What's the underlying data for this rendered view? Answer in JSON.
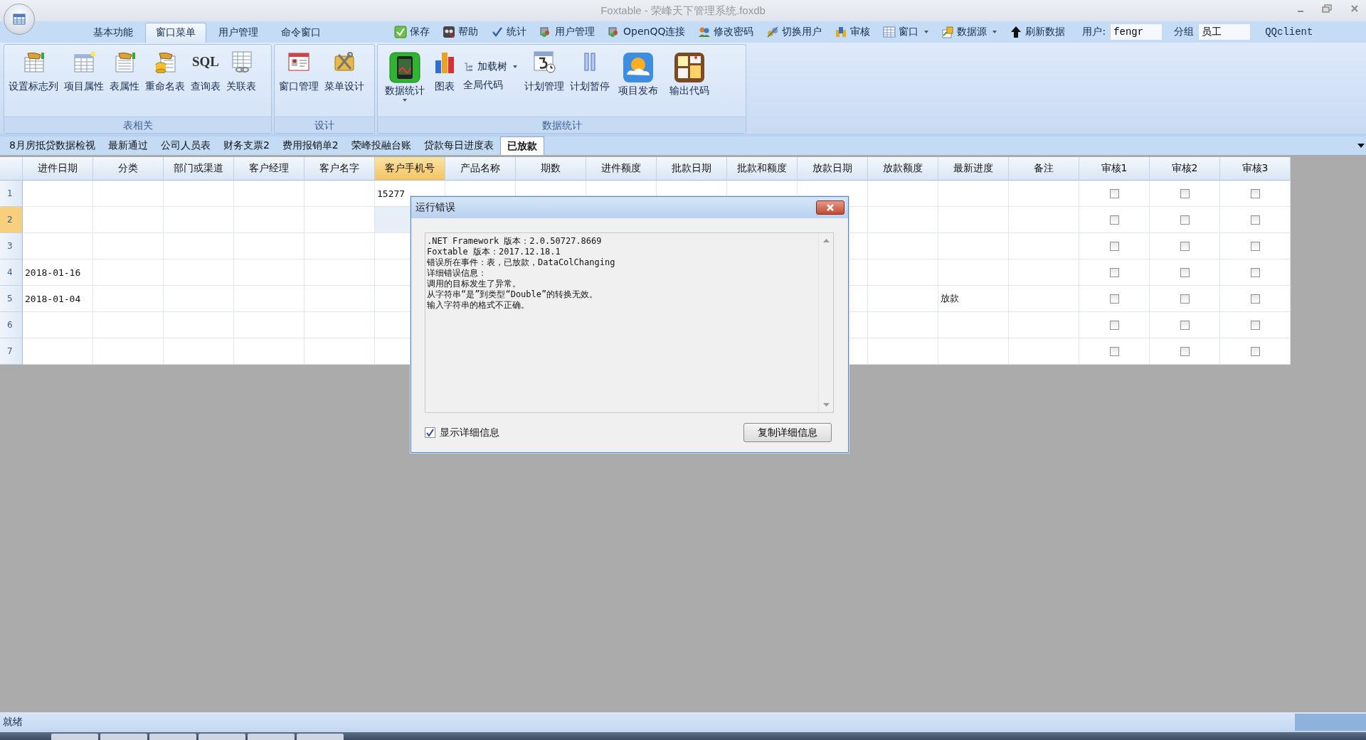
{
  "window": {
    "title": "Foxtable - 荣峰天下管理系统.foxdb"
  },
  "menu_tabs": [
    {
      "label": "基本功能",
      "selected": false
    },
    {
      "label": "窗口菜单",
      "selected": true
    },
    {
      "label": "用户管理",
      "selected": false
    },
    {
      "label": "命令窗口",
      "selected": false
    }
  ],
  "quick_tools": [
    {
      "label": "保存",
      "kind": "check",
      "dropdown": false
    },
    {
      "label": "帮助",
      "kind": "help",
      "dropdown": false
    },
    {
      "label": "统计",
      "kind": "tick",
      "dropdown": false
    },
    {
      "label": "用户管理",
      "kind": "users",
      "dropdown": false
    },
    {
      "label": "OpenQQ连接",
      "kind": "users",
      "dropdown": false
    },
    {
      "label": "修改密码",
      "kind": "people",
      "dropdown": false
    },
    {
      "label": "切换用户",
      "kind": "switch",
      "dropdown": false
    },
    {
      "label": "审核",
      "kind": "coins",
      "dropdown": false
    },
    {
      "label": "窗口",
      "kind": "grid",
      "dropdown": true
    },
    {
      "label": "数据源",
      "kind": "database",
      "dropdown": true
    },
    {
      "label": "刷新数据",
      "kind": "up",
      "dropdown": false
    }
  ],
  "user": {
    "label": "用户:",
    "value": "fengr"
  },
  "group": {
    "label": "分组",
    "value": "员工"
  },
  "qq_client": "QQclient",
  "ribbon_groups": [
    {
      "title": "表相关",
      "items": [
        {
          "label": "设置标志列",
          "kind": "large",
          "dropdown": false
        },
        {
          "label": "项目属性",
          "kind": "large",
          "dropdown": false
        },
        {
          "label": "表属性",
          "kind": "large",
          "dropdown": false
        },
        {
          "label": "重命名表",
          "kind": "large",
          "dropdown": false
        },
        {
          "label": "查询表",
          "kind": "large",
          "icon_text": "SQL",
          "dropdown": false
        },
        {
          "label": "关联表",
          "kind": "large",
          "dropdown": false
        }
      ]
    },
    {
      "title": "设计",
      "items": [
        {
          "label": "窗口管理",
          "kind": "large",
          "dropdown": false
        },
        {
          "label": "菜单设计",
          "kind": "large",
          "dropdown": false
        }
      ]
    },
    {
      "title": "数据统计",
      "items": [
        {
          "label": "数据统计",
          "kind": "big",
          "dropdown": true
        },
        {
          "label": "图表",
          "kind": "large",
          "dropdown": false
        },
        {
          "kind": "stack",
          "items": [
            {
              "label": "加载树",
              "dropdown": true
            },
            {
              "label": "全局代码",
              "dropdown": false
            }
          ]
        },
        {
          "label": "计划管理",
          "kind": "large",
          "dropdown": false
        },
        {
          "label": "计划暂停",
          "kind": "large",
          "dropdown": false
        },
        {
          "label": "项目发布",
          "kind": "big",
          "dropdown": false
        },
        {
          "label": "输出代码",
          "kind": "big",
          "dropdown": false
        }
      ]
    }
  ],
  "sheet_tabs": [
    {
      "label": "8月房抵贷数据检视",
      "selected": false
    },
    {
      "label": "最新通过",
      "selected": false
    },
    {
      "label": "公司人员表",
      "selected": false
    },
    {
      "label": "财务支票2",
      "selected": false
    },
    {
      "label": "费用报销单2",
      "selected": false
    },
    {
      "label": "荣峰投融台账",
      "selected": false
    },
    {
      "label": "贷款每日进度表",
      "selected": false
    },
    {
      "label": "已放款",
      "selected": true
    }
  ],
  "table": {
    "columns": [
      {
        "label": "进件日期",
        "current": false,
        "kind": "text"
      },
      {
        "label": "分类",
        "current": false,
        "kind": "text"
      },
      {
        "label": "部门或渠道",
        "current": false,
        "kind": "text"
      },
      {
        "label": "客户经理",
        "current": false,
        "kind": "text"
      },
      {
        "label": "客户名字",
        "current": false,
        "kind": "text"
      },
      {
        "label": "客户手机号",
        "current": true,
        "kind": "text"
      },
      {
        "label": "产品名称",
        "current": false,
        "kind": "text"
      },
      {
        "label": "期数",
        "current": false,
        "kind": "text"
      },
      {
        "label": "进件额度",
        "current": false,
        "kind": "text"
      },
      {
        "label": "批款日期",
        "current": false,
        "kind": "text"
      },
      {
        "label": "批款和额度",
        "current": false,
        "kind": "text"
      },
      {
        "label": "放款日期",
        "current": false,
        "kind": "text"
      },
      {
        "label": "放款额度",
        "current": false,
        "kind": "text"
      },
      {
        "label": "最新进度",
        "current": false,
        "kind": "text"
      },
      {
        "label": "备注",
        "current": false,
        "kind": "text"
      },
      {
        "label": "审核1",
        "current": false,
        "kind": "check"
      },
      {
        "label": "审核2",
        "current": false,
        "kind": "check"
      },
      {
        "label": "审核3",
        "current": false,
        "kind": "check"
      }
    ],
    "rows": [
      {
        "number": "1",
        "current": false,
        "phone": "15277",
        "audits": [
          false,
          false,
          false
        ]
      },
      {
        "number": "2",
        "current": true,
        "audits": [
          false,
          false,
          false
        ]
      },
      {
        "number": "3",
        "current": false,
        "audits": [
          false,
          false,
          false
        ]
      },
      {
        "number": "4",
        "current": false,
        "entry_date": "2018-01-16",
        "audits": [
          false,
          false,
          false
        ]
      },
      {
        "number": "5",
        "current": false,
        "entry_date": "2018-01-04",
        "progress": "放款",
        "audits": [
          false,
          false,
          false
        ]
      },
      {
        "number": "6",
        "current": false,
        "audits": [
          false,
          false,
          false
        ]
      },
      {
        "number": "7",
        "current": false,
        "audits": [
          false,
          false,
          false
        ]
      }
    ]
  },
  "dialog": {
    "title": "运行错误",
    "details": [
      ".NET Framework 版本：2.0.50727.8669",
      "Foxtable 版本：2017.12.18.1",
      "错误所在事件：表，已放款，DataColChanging",
      "详细错误信息：",
      "调用的目标发生了异常。",
      "从字符串“是”到类型“Double”的转换无效。",
      "输入字符串的格式不正确。"
    ],
    "show_details": {
      "label": "显示详细信息",
      "checked": true
    },
    "copy_button": "复制详细信息"
  },
  "status_bar": {
    "text": "就绪"
  }
}
